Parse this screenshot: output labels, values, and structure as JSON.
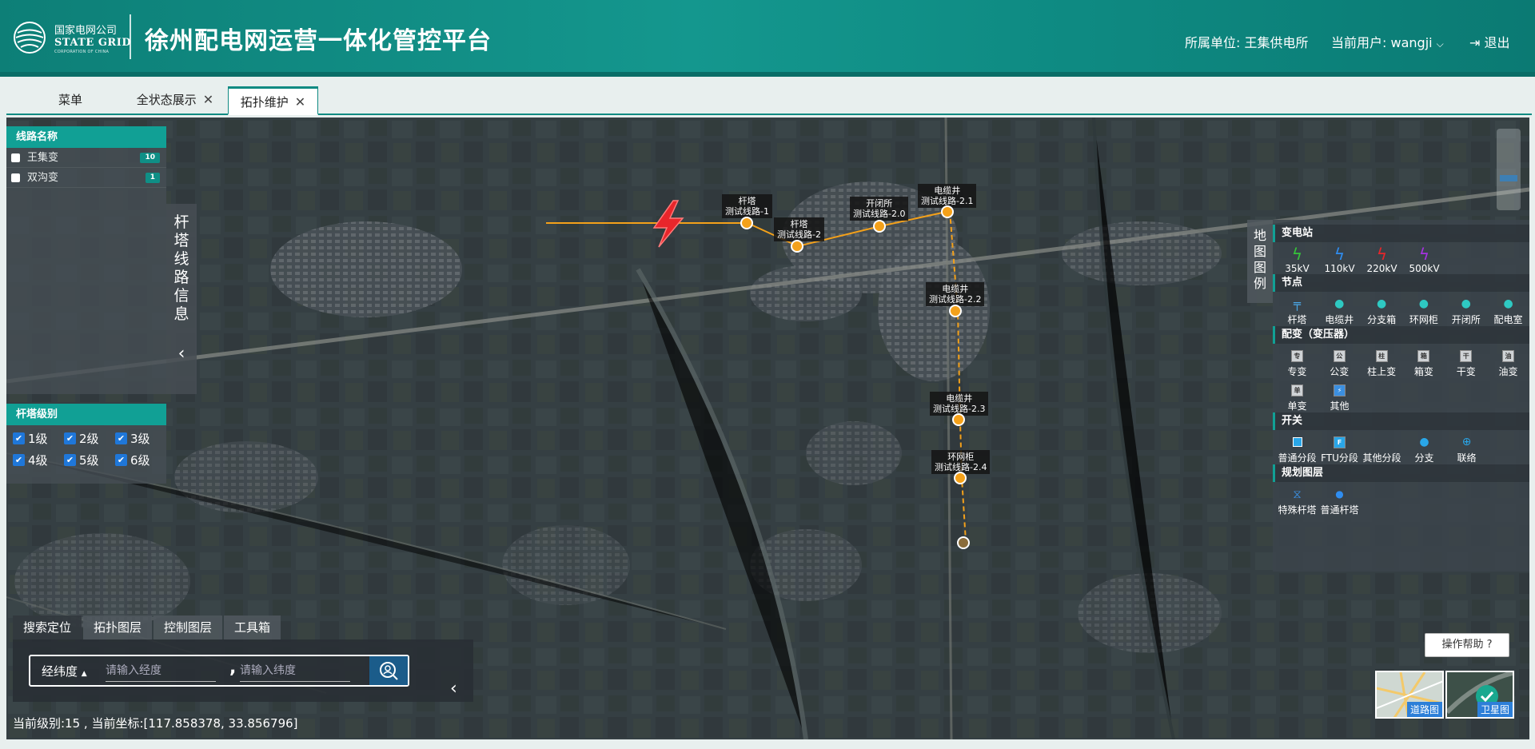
{
  "header": {
    "org_name": "国家电网公司",
    "org_en": "STATE GRID",
    "org_sub": "CORPORATION OF CHINA",
    "title": "徐州配电网运营一体化管控平台",
    "unit_label": "所属单位:",
    "unit_value": "王集供电所",
    "user_label": "当前用户:",
    "user_value": "wangji",
    "logout": "退出"
  },
  "tabs": [
    {
      "label": "菜单",
      "closable": false,
      "active": false
    },
    {
      "label": "全状态展示",
      "closable": true,
      "active": false
    },
    {
      "label": "拓扑维护",
      "closable": true,
      "active": true
    }
  ],
  "lines_panel": {
    "title": "线路名称",
    "items": [
      {
        "label": "王集变",
        "count": "10",
        "checked": false
      },
      {
        "label": "双沟变",
        "count": "1",
        "checked": false
      }
    ]
  },
  "tower_info_tab": "杆塔线路信息",
  "level_panel": {
    "title": "杆塔级别",
    "levels": [
      "1级",
      "2级",
      "3级",
      "4级",
      "5级",
      "6级"
    ]
  },
  "bottom_tabs": [
    "搜索定位",
    "拓扑图层",
    "控制图层",
    "工具箱"
  ],
  "search": {
    "mode_label": "经纬度",
    "lng_placeholder": "请输入经度",
    "lat_placeholder": "请输入纬度",
    "separator": ","
  },
  "status_text": "当前级别:15 , 当前坐标:[117.858378, 33.856796]",
  "legend_tab": "地图图例",
  "legend": {
    "substation": {
      "title": "变电站",
      "items": [
        "35kV",
        "110kV",
        "220kV",
        "500kV"
      ],
      "colors": [
        "#36c43a",
        "#2f8df0",
        "#e8262b",
        "#a632e0"
      ]
    },
    "nodes": {
      "title": "节点",
      "items": [
        "杆塔",
        "电缆井",
        "分支箱",
        "环网柜",
        "开闭所",
        "配电室"
      ]
    },
    "transformers": {
      "title": "配变（变压器）",
      "items": [
        "专变",
        "公变",
        "柱上变",
        "箱变",
        "干变",
        "油变",
        "单变",
        "其他"
      ],
      "glyphs": [
        "专",
        "公",
        "柱",
        "箱",
        "干",
        "油",
        "单",
        "⚡"
      ]
    },
    "switches": {
      "title": "开关",
      "items": [
        "普通分段",
        "FTU分段",
        "其他分段",
        "分支",
        "联络"
      ]
    },
    "planning": {
      "title": "规划图层",
      "items": [
        "特殊杆塔",
        "普通杆塔"
      ]
    }
  },
  "help_button": "操作帮助",
  "map_types": [
    "道路图",
    "卫星图"
  ],
  "map_markers": [
    {
      "type": "杆塔",
      "line": "测试线路-1"
    },
    {
      "type": "杆塔",
      "line": "测试线路-2"
    },
    {
      "type": "开闭所",
      "line": "测试线路-2.0"
    },
    {
      "type": "电缆井",
      "line": "测试线路-2.1"
    },
    {
      "type": "电缆井",
      "line": "测试线路-2.2"
    },
    {
      "type": "电缆井",
      "line": "测试线路-2.3"
    },
    {
      "type": "环网柜",
      "line": "测试线路-2.4"
    }
  ],
  "colors": {
    "brand": "#0f8a82",
    "accent": "#11a095",
    "line": "#f4a11a"
  }
}
